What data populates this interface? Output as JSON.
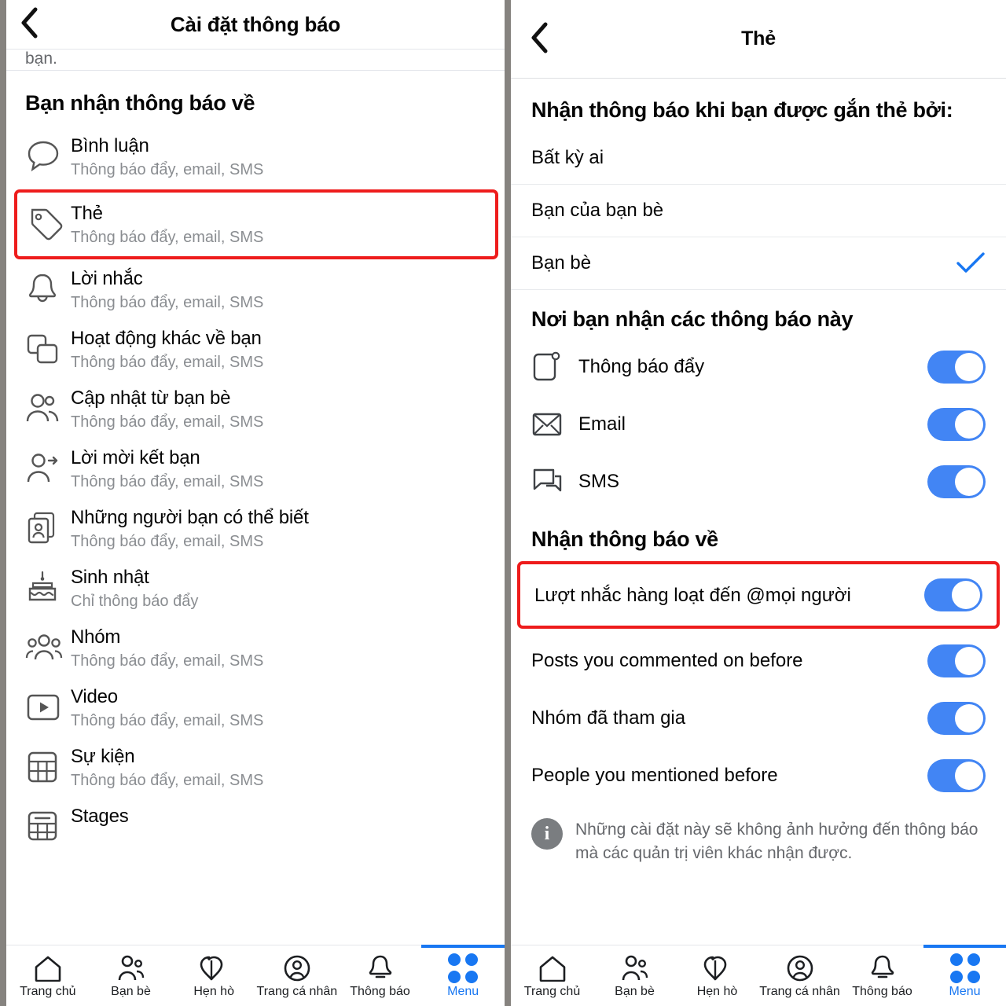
{
  "left": {
    "header": {
      "title": "Cài đặt thông báo",
      "back_icon": "chevron-left-icon"
    },
    "cut_text": "bạn.",
    "section_title": "Bạn nhận thông báo về",
    "items": [
      {
        "icon": "comment-bubble-icon",
        "title": "Bình luận",
        "subtitle": "Thông báo đẩy, email, SMS",
        "highlighted": false
      },
      {
        "icon": "tag-icon",
        "title": "Thẻ",
        "subtitle": "Thông báo đẩy, email, SMS",
        "highlighted": true
      },
      {
        "icon": "bell-icon",
        "title": "Lời nhắc",
        "subtitle": "Thông báo đẩy, email, SMS",
        "highlighted": false
      },
      {
        "icon": "stacked-squares-icon",
        "title": "Hoạt động khác về bạn",
        "subtitle": "Thông báo đẩy, email, SMS",
        "highlighted": false
      },
      {
        "icon": "two-people-icon",
        "title": "Cập nhật từ bạn bè",
        "subtitle": "Thông báo đẩy, email, SMS",
        "highlighted": false
      },
      {
        "icon": "person-arrow-icon",
        "title": "Lời mời kết bạn",
        "subtitle": "Thông báo đẩy, email, SMS",
        "highlighted": false
      },
      {
        "icon": "contact-cards-icon",
        "title": "Những người bạn có thể biết",
        "subtitle": "Thông báo đẩy, email, SMS",
        "highlighted": false
      },
      {
        "icon": "birthday-cake-icon",
        "title": "Sinh nhật",
        "subtitle": "Chỉ thông báo đẩy",
        "highlighted": false
      },
      {
        "icon": "three-people-icon",
        "title": "Nhóm",
        "subtitle": "Thông báo đẩy, email, SMS",
        "highlighted": false
      },
      {
        "icon": "video-play-icon",
        "title": "Video",
        "subtitle": "Thông báo đẩy, email, SMS",
        "highlighted": false
      },
      {
        "icon": "calendar-grid-icon",
        "title": "Sự kiện",
        "subtitle": "Thông báo đẩy, email, SMS",
        "highlighted": false
      },
      {
        "icon": "stage-icon",
        "title": "Stages",
        "subtitle": "",
        "highlighted": false
      }
    ]
  },
  "right": {
    "header": {
      "title": "Thẻ",
      "back_icon": "chevron-left-icon"
    },
    "question_title": "Nhận thông báo khi bạn được gắn thẻ bởi:",
    "options": [
      {
        "label": "Bất kỳ ai",
        "selected": false
      },
      {
        "label": "Bạn của bạn bè",
        "selected": false
      },
      {
        "label": "Bạn bè",
        "selected": true
      }
    ],
    "channels_title": "Nơi bạn nhận các thông báo này",
    "channels": [
      {
        "icon": "push-notification-icon",
        "label": "Thông báo đẩy",
        "on": true
      },
      {
        "icon": "envelope-icon",
        "label": "Email",
        "on": true
      },
      {
        "icon": "sms-bubbles-icon",
        "label": "SMS",
        "on": true
      }
    ],
    "about_title": "Nhận thông báo về",
    "about_items": [
      {
        "label": "Lượt nhắc hàng loạt đến @mọi người",
        "on": true,
        "highlighted": true
      },
      {
        "label": "Posts you commented on before",
        "on": true,
        "highlighted": false
      },
      {
        "label": "Nhóm đã tham gia",
        "on": true,
        "highlighted": false
      },
      {
        "label": "People you mentioned before",
        "on": true,
        "highlighted": false
      }
    ],
    "info": {
      "icon": "info-icon",
      "text": "Những cài đặt này sẽ không ảnh hưởng đến thông báo mà các quản trị viên khác nhận được."
    }
  },
  "bottom_nav": {
    "items": [
      {
        "icon": "home-icon",
        "label": "Trang chủ",
        "active": false
      },
      {
        "icon": "friends-icon",
        "label": "Bạn bè",
        "active": false
      },
      {
        "icon": "dating-hearts-icon",
        "label": "Hẹn hò",
        "active": false
      },
      {
        "icon": "profile-circle-icon",
        "label": "Trang cá nhân",
        "active": false
      },
      {
        "icon": "bell-icon",
        "label": "Thông báo",
        "active": false
      },
      {
        "icon": "menu-grid-icon",
        "label": "Menu",
        "active": true
      }
    ]
  },
  "colors": {
    "accent_blue": "#1877f2",
    "toggle_blue": "#4285f4",
    "highlight_red": "#ee1c1c",
    "text_primary": "#050505",
    "text_secondary": "#8a8d91"
  }
}
